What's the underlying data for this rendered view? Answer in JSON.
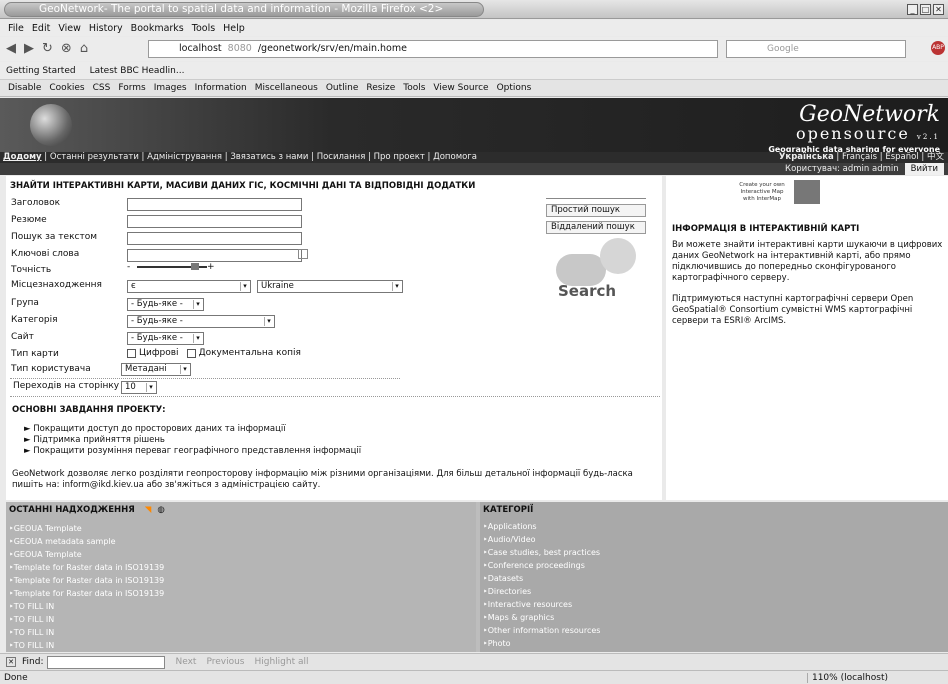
{
  "window": {
    "title": "GeoNetwork- The portal to spatial data and information - Mozilla Firefox <2>"
  },
  "menu": [
    "File",
    "Edit",
    "View",
    "History",
    "Bookmarks",
    "Tools",
    "Help"
  ],
  "nav": {
    "url_host": "localhost",
    "url_port": "8080",
    "url_path": "/geonetwork/srv/en/main.home",
    "search_engine": "Google"
  },
  "bookmarks": [
    "Getting Started",
    "Latest BBC Headlin..."
  ],
  "webdev": [
    "Disable",
    "Cookies",
    "CSS",
    "Forms",
    "Images",
    "Information",
    "Miscellaneous",
    "Outline",
    "Resize",
    "Tools",
    "View Source",
    "Options"
  ],
  "banner": {
    "logo_top": "GeoNetwork",
    "logo_bottom": "opensource",
    "version": "v2.1",
    "tagline": "Geographic data sharing for everyone"
  },
  "topnav": {
    "links": [
      "Додому",
      "Останні результати",
      "Адміністрування",
      "Звязатись з нами",
      "Посилання",
      "Про проект",
      "Допомога"
    ],
    "languages": [
      "Українська",
      "Français",
      "Español",
      "中文"
    ],
    "user": "Користувач: admin admin",
    "logout": "Вийти"
  },
  "search": {
    "heading": "ЗНАЙТИ ІНТЕРАКТИВНІ КАРТИ, МАСИВИ ДАНИХ ГІС, КОСМІЧНІ ДАНІ ТА ВІДПОВІДНІ ДОДАТКИ",
    "labels": [
      "Заголовок",
      "Резюме",
      "Пошук за текстом",
      "Ключові слова",
      "Точність",
      "Місцезнаходження",
      "Група",
      "Категорія",
      "Сайт",
      "Тип карти",
      "Тип користувача",
      "Переходів на сторінку"
    ],
    "location_value": "є",
    "country_value": "Ukraine",
    "any": "- Будь-яке -",
    "map_type": [
      "Цифрові",
      "Документальна копія"
    ],
    "user_type": "Метадані",
    "per_page": "10",
    "simple": "Простий пошук",
    "advanced": "Віддалений пошук",
    "search_button": "Search"
  },
  "tasks": {
    "heading": "ОСНОВНІ ЗАВДАННЯ ПРОЕКТУ:",
    "items": [
      "Покращити доступ до просторових даних та інформації",
      "Підтримка прийняття рішень",
      "Покращити розуміння переваг географічного представлення інформації"
    ],
    "para": "GeoNetwork дозволяє легко розділяти геопросторову інформацію між різними організаціями. Для більш детальної інформації будь-ласка пишіть на: inform@ikd.kiev.ua або зв'яжіться з адміністрацією сайту."
  },
  "sidebar": {
    "promo": [
      "Create your own",
      "Interactive Map",
      "with InterMap"
    ],
    "heading": "ІНФОРМАЦІЯ В ІНТЕРАКТИВНІЙ КАРТІ",
    "p1": "Ви можете знайти інтерактивні карти шукаючи в цифрових даних GeoNetwork на інтерактивній карті, або прямо підключившись до попередньо сконфігурованого картографічного серверу.",
    "p2": "Підтримуються наступні картографічні сервери Open GeoSpatial® Consortium сумвістні WMS картографічні сервери та ESRI® ArcIMS."
  },
  "recent": {
    "heading": "ОСТАННІ НАДХОДЖЕННЯ",
    "items": [
      "GEOUA Template",
      "GEOUA metadata sample",
      "GEOUA Template",
      "Template for Raster data in ISO19139",
      "Template for Raster data in ISO19139",
      "Template for Raster data in ISO19139",
      "TO FILL IN",
      "TO FILL IN",
      "TO FILL IN",
      "TO FILL IN"
    ]
  },
  "categories": {
    "heading": "КАТЕГОРІЇ",
    "items": [
      "Applications",
      "Audio/Video",
      "Case studies, best practices",
      "Conference proceedings",
      "Datasets",
      "Directories",
      "Interactive resources",
      "Maps & graphics",
      "Other information resources",
      "Photo"
    ]
  },
  "find": {
    "label": "Find:",
    "next": "Next",
    "previous": "Previous",
    "highlight": "Highlight all"
  },
  "status": {
    "left": "Done",
    "zoom": "110% (localhost)"
  }
}
